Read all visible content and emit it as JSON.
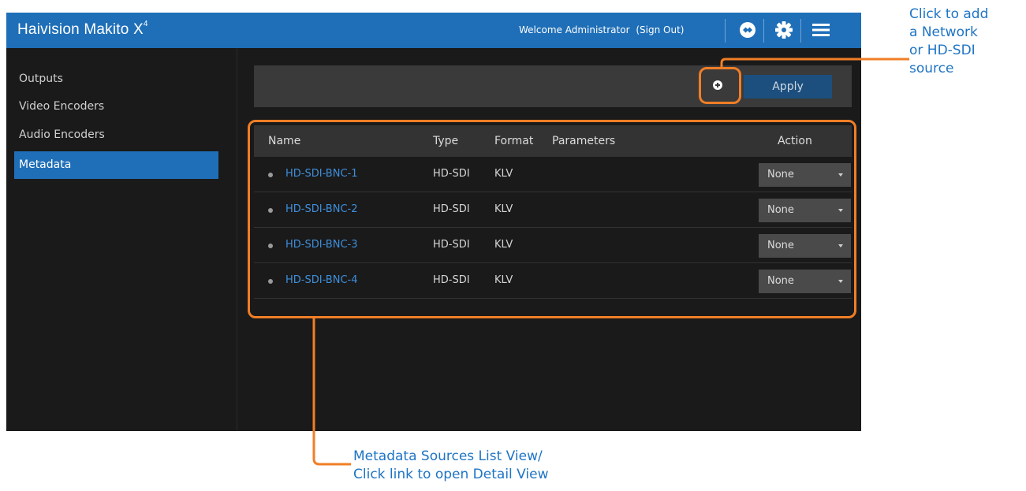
{
  "app": {
    "brand": "Haivision Makito X",
    "brand_sup": "4",
    "welcome": "Welcome Administrator",
    "sign_out": "(Sign Out)"
  },
  "topbar_icons": [
    "status-icon",
    "gear-icon",
    "menu-icon"
  ],
  "sidebar": {
    "items": [
      {
        "label": "Outputs",
        "active": false
      },
      {
        "label": "Video Encoders",
        "active": false
      },
      {
        "label": "Audio Encoders",
        "active": false
      },
      {
        "label": "Metadata",
        "active": true
      }
    ]
  },
  "toolbar": {
    "add_icon": "plus-circle-icon",
    "apply_label": "Apply"
  },
  "table": {
    "columns": [
      "Name",
      "Type",
      "Format",
      "Parameters",
      "Action"
    ],
    "rows": [
      {
        "name": "HD-SDI-BNC-1",
        "type": "HD-SDI",
        "format": "KLV",
        "parameters": "",
        "action": "None"
      },
      {
        "name": "HD-SDI-BNC-2",
        "type": "HD-SDI",
        "format": "KLV",
        "parameters": "",
        "action": "None"
      },
      {
        "name": "HD-SDI-BNC-3",
        "type": "HD-SDI",
        "format": "KLV",
        "parameters": "",
        "action": "None"
      },
      {
        "name": "HD-SDI-BNC-4",
        "type": "HD-SDI",
        "format": "KLV",
        "parameters": "",
        "action": "None"
      }
    ]
  },
  "callouts": {
    "add_source": [
      "Click to add",
      "a Network",
      "or HD-SDI",
      "source"
    ],
    "list_view": [
      "Metadata Sources List View/",
      "Click link to open Detail View"
    ]
  },
  "colors": {
    "topbar": "#1f6fb8",
    "active_nav": "#1f6fb8",
    "link": "#3e8fdc",
    "callout": "#f07e26",
    "callout_text": "#1e74c4",
    "background": "#1a1a1a"
  }
}
